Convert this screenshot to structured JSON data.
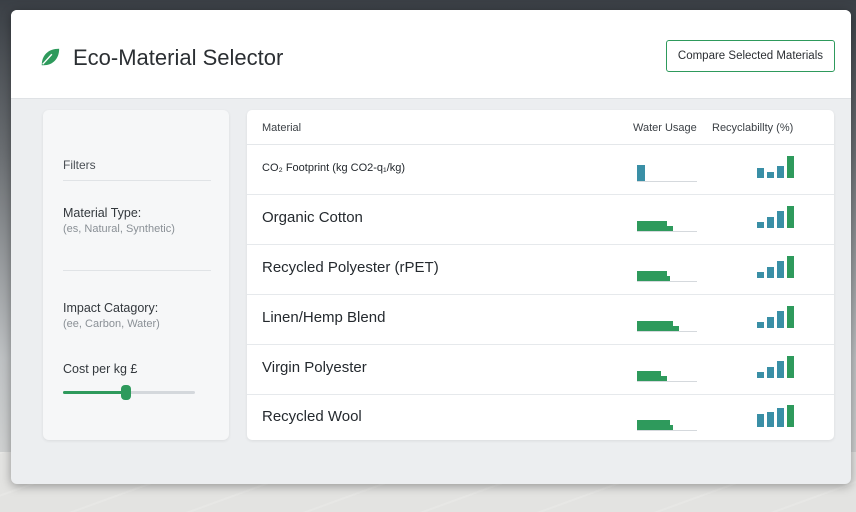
{
  "app": {
    "title": "Eco-Material Selector",
    "compare_label": "Compare Selected Materials"
  },
  "filters": {
    "title": "Filters",
    "material_type_label": "Material Type:",
    "material_type_hint": "(es, Natural, Synthetic)",
    "impact_label": "Impact Catagory:",
    "impact_hint": "(ee, Carbon, Water)",
    "cost_label": "Cost per kg £",
    "cost_slider_fraction": 0.48
  },
  "table": {
    "columns": [
      "Material",
      "Water Usage",
      "Recyclabillty (%)"
    ],
    "rows": [
      {
        "name": "CO₂ Footprint (kg CO2-q₁/kg)",
        "small": true,
        "water": [
          0.13
        ],
        "recy": [
          0.45,
          0.25,
          0.55,
          1.0
        ]
      },
      {
        "name": "Organic Cotton",
        "water": [
          0.5,
          0.6
        ],
        "recy": [
          0.25,
          0.5,
          0.75,
          1.0
        ]
      },
      {
        "name": "Recycled Polyester (rPET)",
        "water": [
          0.5,
          0.55
        ],
        "recy": [
          0.25,
          0.5,
          0.75,
          1.0
        ]
      },
      {
        "name": "Linen/Hemp Blend",
        "water": [
          0.6,
          0.7
        ],
        "recy": [
          0.25,
          0.5,
          0.75,
          1.0
        ]
      },
      {
        "name": "Virgin Polyester",
        "water": [
          0.4,
          0.5
        ],
        "recy": [
          0.25,
          0.5,
          0.75,
          1.0
        ]
      },
      {
        "name": "Recycled Wool",
        "water": [
          0.55,
          0.6
        ],
        "recy": [
          0.6,
          0.7,
          0.85,
          1.0
        ]
      }
    ]
  },
  "colors": {
    "accent": "#2e9a5c",
    "recy_bar_a": "#3a8fa6",
    "recy_bar_b": "#2e9a5c"
  }
}
